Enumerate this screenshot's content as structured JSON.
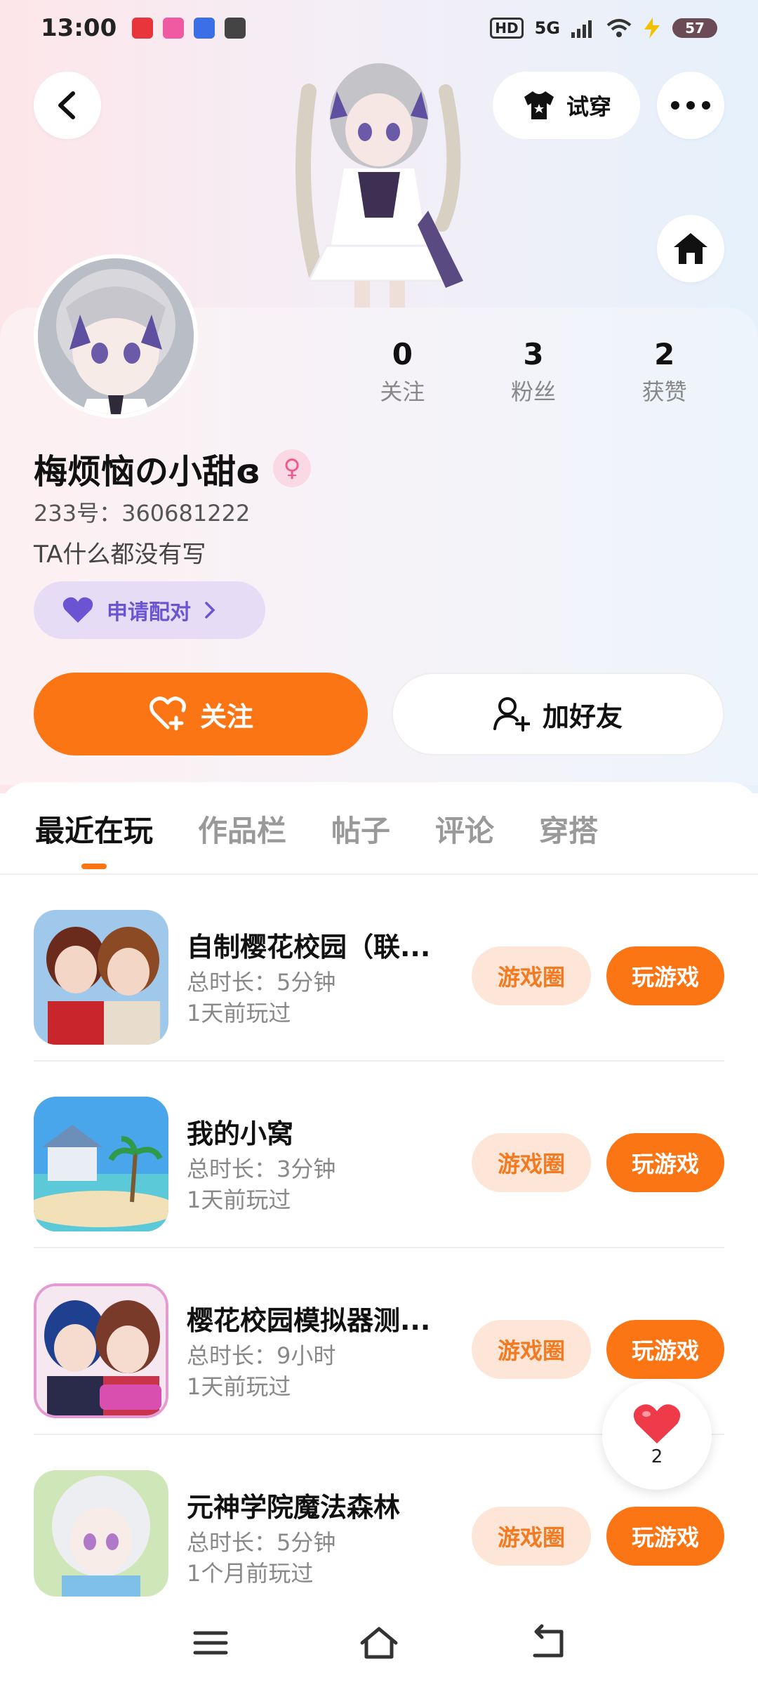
{
  "status_bar": {
    "time": "13:00",
    "network": "5G",
    "hd": "HD",
    "battery": "57"
  },
  "header": {
    "tryon_label": "试穿"
  },
  "profile": {
    "name": "梅烦恼の小甜ɞ",
    "gender_icon": "female-icon",
    "uid": "233号：360681222",
    "bio": "TA什么都没有写",
    "pair_label": "申请配对",
    "stats": [
      {
        "value": "0",
        "label": "关注"
      },
      {
        "value": "3",
        "label": "粉丝"
      },
      {
        "value": "2",
        "label": "获赞"
      }
    ],
    "follow_label": "关注",
    "add_friend_label": "加好友"
  },
  "tabs": [
    {
      "label": "最近在玩",
      "active": true
    },
    {
      "label": "作品栏",
      "active": false
    },
    {
      "label": "帖子",
      "active": false
    },
    {
      "label": "评论",
      "active": false
    },
    {
      "label": "穿搭",
      "active": false
    }
  ],
  "games": [
    {
      "title": "自制樱花校园（联...",
      "duration": "总时长：5分钟",
      "last_played": "1天前玩过",
      "circle_label": "游戏圈",
      "play_label": "玩游戏"
    },
    {
      "title": "我的小窝",
      "duration": "总时长：3分钟",
      "last_played": "1天前玩过",
      "circle_label": "游戏圈",
      "play_label": "玩游戏"
    },
    {
      "title": "樱花校园模拟器测...",
      "duration": "总时长：9小时",
      "last_played": "1天前玩过",
      "circle_label": "游戏圈",
      "play_label": "玩游戏"
    },
    {
      "title": "元神学院魔法森林",
      "duration": "总时长：5分钟",
      "last_played": "1个月前玩过",
      "circle_label": "游戏圈",
      "play_label": "玩游戏"
    }
  ],
  "like_float": {
    "count": "2"
  },
  "colors": {
    "accent": "#fb7514",
    "accent_light": "#fde6d7",
    "pair_purple": "#6a54d2"
  }
}
